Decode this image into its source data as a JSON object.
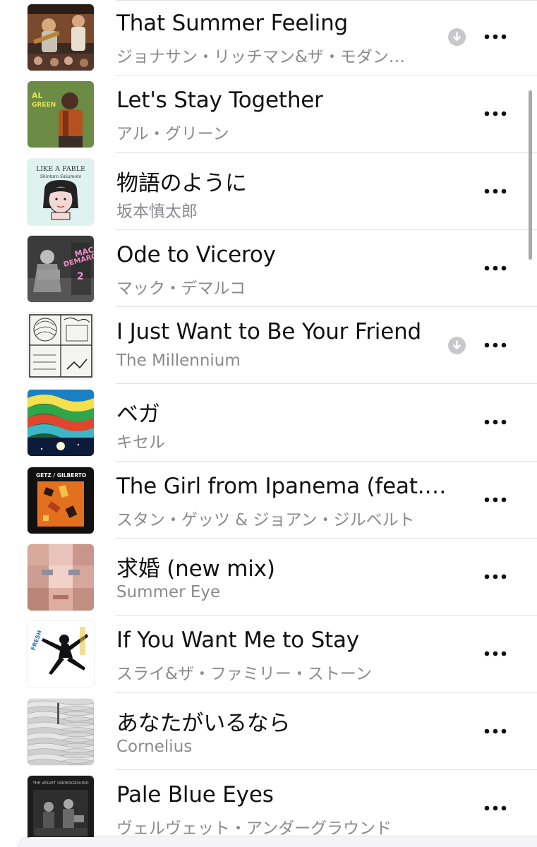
{
  "tracks": [
    {
      "title": "That Summer Feeling",
      "artist": "ジョナサン・リッチマン&ザ・モダン…",
      "downloaded": true,
      "artwork_icon": "album-art-that-summer-feeling"
    },
    {
      "title": "Let's Stay Together",
      "artist": "アル・グリーン",
      "downloaded": false,
      "artwork_icon": "album-art-lets-stay-together"
    },
    {
      "title": "物語のように",
      "artist": "坂本慎太郎",
      "downloaded": false,
      "artwork_icon": "album-art-like-a-fable"
    },
    {
      "title": "Ode to Viceroy",
      "artist": "マック・デマルコ",
      "downloaded": false,
      "artwork_icon": "album-art-mac-demarco-2"
    },
    {
      "title": "I Just Want to Be Your Friend",
      "artist": "The Millennium",
      "downloaded": true,
      "artwork_icon": "album-art-begin"
    },
    {
      "title": "ベガ",
      "artist": "キセル",
      "downloaded": false,
      "artwork_icon": "album-art-vega"
    },
    {
      "title": "The Girl from Ipanema (feat. As...",
      "artist": "スタン・ゲッツ & ジョアン・ジルベルト",
      "downloaded": false,
      "artwork_icon": "album-art-getz-gilberto"
    },
    {
      "title": "求婚 (new mix)",
      "artist": "Summer Eye",
      "downloaded": false,
      "artwork_icon": "album-art-summer-eye"
    },
    {
      "title": "If You Want Me to Stay",
      "artist": "スライ&ザ・ファミリー・ストーン",
      "downloaded": false,
      "artwork_icon": "album-art-fresh"
    },
    {
      "title": "あなたがいるなら",
      "artist": "Cornelius",
      "downloaded": false,
      "artwork_icon": "album-art-mellow-waves"
    },
    {
      "title": "Pale Blue Eyes",
      "artist": "ヴェルヴェット・アンダーグラウンド",
      "downloaded": false,
      "artwork_icon": "album-art-velvet-underground"
    }
  ],
  "album_art_text": {
    "like_a_fable_line1": "LIKE A FABLE",
    "like_a_fable_line2": "Shintaro Sakamoto",
    "mac_demarco_line1": "MAC",
    "mac_demarco_line2": "DEMARCO",
    "mac_demarco_line3": "2",
    "getz_gilberto": "GETZ / GILBERTO",
    "fresh": "FRESH",
    "velvet": "THE VELVET UNDERGROUND"
  },
  "colors": {
    "title_text": "#111111",
    "subtitle_text": "#8a8a8e",
    "divider": "#e0e0e3",
    "download_icon": "#c7c7cc",
    "more_icon": "#111111",
    "scrollbar": "#a9a9ad"
  },
  "icons": {
    "download": "arrow-down-circle-icon",
    "more": "ellipsis-icon"
  }
}
